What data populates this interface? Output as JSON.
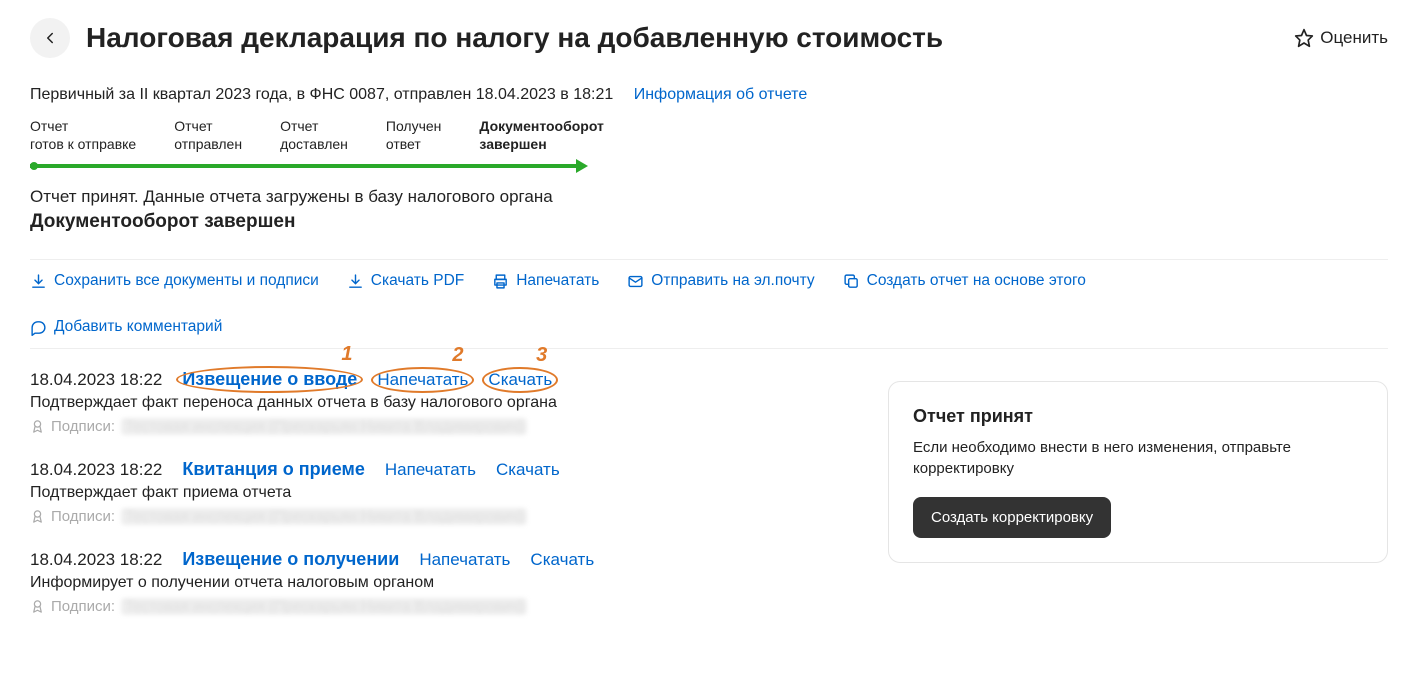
{
  "header": {
    "title": "Налоговая декларация по налогу на добавленную стоимость",
    "rate_label": "Оценить"
  },
  "meta": {
    "summary": "Первичный за II квартал 2023 года, в ФНС 0087, отправлен 18.04.2023 в 18:21",
    "info_link": "Информация об отчете"
  },
  "stages": [
    {
      "l1": "Отчет",
      "l2": "готов к отправке"
    },
    {
      "l1": "Отчет",
      "l2": "отправлен"
    },
    {
      "l1": "Отчет",
      "l2": "доставлен"
    },
    {
      "l1": "Получен",
      "l2": "ответ"
    },
    {
      "l1": "Документооборот",
      "l2": "завершен",
      "bold": true
    }
  ],
  "status": {
    "line1": "Отчет принят. Данные отчета загружены в базу налогового органа",
    "line2": "Документооборот завершен"
  },
  "actions": {
    "save_all": "Сохранить все документы и подписи",
    "download_pdf": "Скачать PDF",
    "print": "Напечатать",
    "email": "Отправить на эл.почту",
    "create_based": "Создать отчет на основе этого",
    "add_comment": "Добавить комментарий"
  },
  "events": [
    {
      "ts": "18.04.2023 18:22",
      "main": "Извещение о вводе",
      "print": "Напечатать",
      "download": "Скачать",
      "desc": "Подтверждает факт переноса данных отчета в базу налогового органа",
      "sign_label": "Подписи:",
      "sign_value": "Тестовая инспекция (Прескарьян Никита Владимирович)",
      "annotated": true
    },
    {
      "ts": "18.04.2023 18:22",
      "main": "Квитанция о приеме",
      "print": "Напечатать",
      "download": "Скачать",
      "desc": "Подтверждает факт приема отчета",
      "sign_label": "Подписи:",
      "sign_value": "Тестовая инспекция (Прескарьян Никита Владимирович)"
    },
    {
      "ts": "18.04.2023 18:22",
      "main": "Извещение о получении",
      "print": "Напечатать",
      "download": "Скачать",
      "desc": "Информирует о получении отчета налоговым органом",
      "sign_label": "Подписи:",
      "sign_value": "Тестовая инспекция (Прескарьян Никита Владимирович)"
    }
  ],
  "annotations": {
    "n1": "1",
    "n2": "2",
    "n3": "3"
  },
  "panel": {
    "title": "Отчет принят",
    "text": "Если необходимо внести в него изменения, отправьте корректировку",
    "button": "Создать корректировку"
  }
}
